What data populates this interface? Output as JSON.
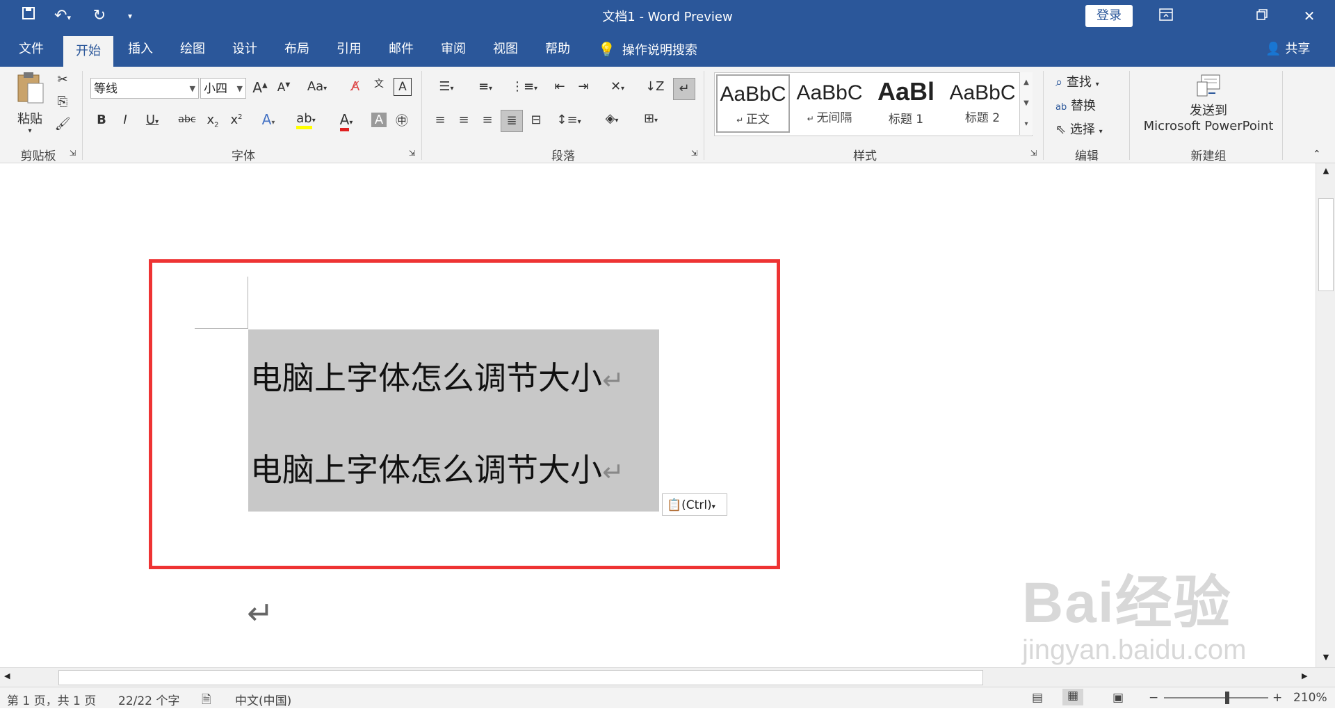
{
  "title_bar": {
    "title": "文档1  -  Word Preview",
    "login_label": "登录",
    "icons": [
      "save-icon",
      "undo-icon",
      "redo-icon",
      "customize-qat-icon",
      "ribbon-display-icon",
      "restore-icon",
      "close-icon"
    ]
  },
  "tabs": [
    {
      "label": "文件"
    },
    {
      "label": "开始",
      "active": true
    },
    {
      "label": "插入"
    },
    {
      "label": "绘图"
    },
    {
      "label": "设计"
    },
    {
      "label": "布局"
    },
    {
      "label": "引用"
    },
    {
      "label": "邮件"
    },
    {
      "label": "审阅"
    },
    {
      "label": "视图"
    },
    {
      "label": "帮助"
    }
  ],
  "tell_me": "操作说明搜索",
  "share_label": "共享",
  "ribbon": {
    "clipboard": {
      "label": "剪贴板",
      "paste_label": "粘贴"
    },
    "font": {
      "label": "字体",
      "font_name": "等线",
      "font_size": "小四",
      "aa_label": "Aa"
    },
    "paragraph": {
      "label": "段落"
    },
    "styles": {
      "label": "样式",
      "items": [
        {
          "sample": "AaBbC",
          "name": "正文",
          "selected": true
        },
        {
          "sample": "AaBbC",
          "name": "无间隔"
        },
        {
          "sample": "AaBl",
          "name": "标题 1"
        },
        {
          "sample": "AaBbC",
          "name": "标题 2"
        }
      ]
    },
    "editing": {
      "label": "编辑",
      "find": "查找",
      "replace": "替换",
      "select": "选择"
    },
    "new_group": {
      "label": "新建组",
      "send_line1": "发送到",
      "send_line2": "Microsoft PowerPoint"
    }
  },
  "document": {
    "lines": [
      "电脑上字体怎么调节大小",
      "电脑上字体怎么调节大小"
    ],
    "paste_options_label": "(Ctrl)",
    "watermark_main": "Bai经验",
    "watermark_sub": "jingyan.baidu.com"
  },
  "status": {
    "page": "第 1 页，共 1 页",
    "words": "22/22 个字",
    "language": "中文(中国)",
    "zoom": "210%"
  },
  "colors": {
    "brand": "#2b579a",
    "highlight_box": "#ee3333",
    "selection": "#c8c8c8"
  }
}
